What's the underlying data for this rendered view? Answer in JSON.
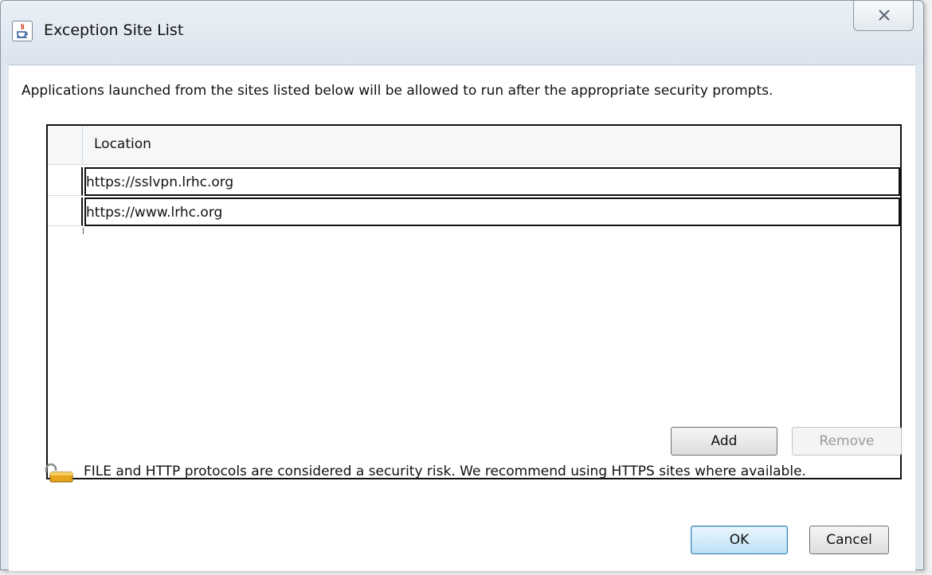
{
  "window": {
    "title": "Exception Site List",
    "icon": "java-icon",
    "close_glyph": "close-icon"
  },
  "description": "Applications launched from the sites listed below will be allowed to run after the appropriate security prompts.",
  "table": {
    "header": "Location",
    "rows": [
      "https://sslvpn.lrhc.org",
      "https://www.lrhc.org"
    ]
  },
  "buttons": {
    "add": "Add",
    "remove": "Remove",
    "ok": "OK",
    "cancel": "Cancel"
  },
  "warning": {
    "icon": "padlock-icon",
    "text": "FILE and HTTP protocols are considered a security risk.  We recommend using HTTPS sites where available."
  },
  "colors": {
    "window_frame": "#dfe7ef",
    "ok_button": "#bfe1f6",
    "disabled_text": "#9a9a9a"
  }
}
